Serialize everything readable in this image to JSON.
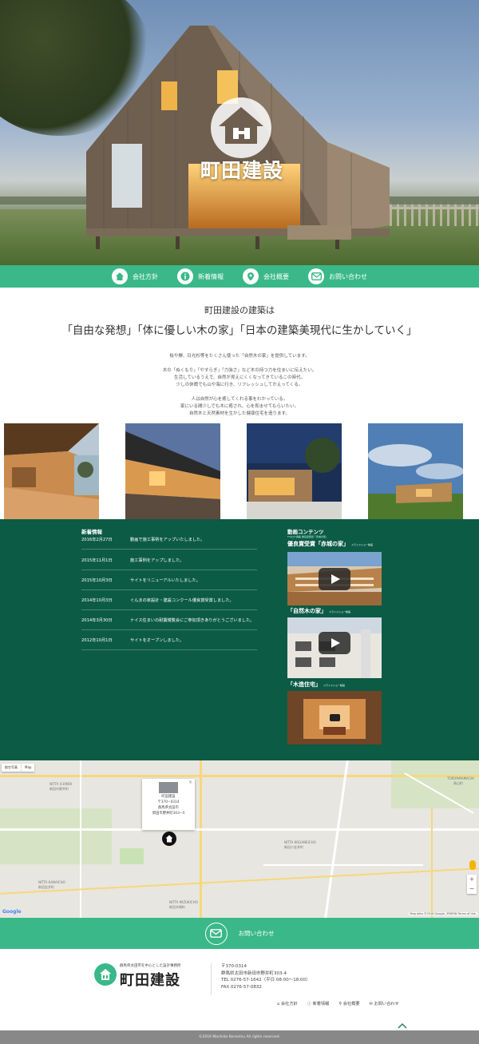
{
  "brand": {
    "name": "町田建設"
  },
  "nav": [
    {
      "label": "会社方針",
      "icon": "home-icon"
    },
    {
      "label": "新着情報",
      "icon": "info-icon"
    },
    {
      "label": "会社概要",
      "icon": "map-pin-icon"
    },
    {
      "label": "お問い合わせ",
      "icon": "mail-icon"
    }
  ],
  "intro": {
    "heading": "町田建設の建築は",
    "tagline": "「自由な発想」「体に優しい木の家」「日本の建築美現代に生かしていく」",
    "p1": "桧や欅、日光杉等をたくさん使った「自然木の家」を提供しています。",
    "p2": [
      "木の「ぬくもり」「やすらぎ」「力強さ」など木の持つ力を住まいに伝えたい。",
      "生活しているうえで、自然が見えにくくなってきているこの時代。",
      "少しの休暇でも山や海に行き、リフレッシュしてかえってくる。"
    ],
    "p3": [
      "人は自然が心を癒してくれる事をわかっている。",
      "家にいる間少しでも木に癒され、心を和ませてもらいたい。",
      "自然木と天然素材を生かした健康住宅を造ります。"
    ]
  },
  "news": {
    "title": "新着情報",
    "items": [
      {
        "date": "2016年2月27日",
        "text": "動画で施工事例をアップいたしました。"
      },
      {
        "date": "2015年11月1日",
        "text": "施工事例をアップしました。"
      },
      {
        "date": "2015年10月3日",
        "text": "サイトをリニューアルいたしました。"
      },
      {
        "date": "2014年10月3日",
        "text": "ぐんまの家設計・建設コンクール優良賞受賞しました。"
      },
      {
        "date": "2014年3月30日",
        "text": "ナイス住まいの耐震博覧会にご参加頂きありがとうございました。"
      },
      {
        "date": "2012年10月1日",
        "text": "サイトをオープンしました。"
      }
    ]
  },
  "videos": {
    "title": "動画コンテンツ",
    "sub": "TV/ロケ番組 優良賞受賞「赤城の家」",
    "items": [
      {
        "label": "優良賞受賞「赤城の家」",
        "small": "スライドショー動画"
      },
      {
        "label": "「自然木の家」",
        "small": "スライドショー動画"
      },
      {
        "label": "「木造住宅」",
        "small": "スライドショー動画"
      }
    ]
  },
  "map": {
    "type_map": "Map",
    "type_sat": "航空写真",
    "popup": {
      "name": "町田建設",
      "zip": "〒370−0314",
      "addr1": "群馬県太田市",
      "addr2": "新田市野井町303−4"
    },
    "labels": [
      "NITTA ICHINOI",
      "NITTA KOGANEICHO",
      "NITTA KANAICHO",
      "NITTA MIZUKICHO",
      "TORIYAMAMACHI",
      "新田市野井町",
      "新田小金井町",
      "新田金井町",
      "新田木崎町",
      "鳥山町"
    ],
    "credit": "Map data ©2016 Google, ZENRIN  Terms of Use",
    "google": "Google"
  },
  "contact": {
    "label": "お問い合わせ"
  },
  "footer": {
    "logo_sub": "群馬県太田市を中心とした設計事務所",
    "zip": "〒370-0314",
    "address": "群馬県太田市新田市野井町303-4",
    "tel": "TEL 0276-57-1642（平日 08:00〜18:00）",
    "fax": "FAX 0276-57-0832",
    "links": [
      "会社方針",
      "新着情報",
      "会社概要",
      "お問い合わせ"
    ]
  },
  "copyright": "©2016 Machida Kensetsu All rights reserved."
}
